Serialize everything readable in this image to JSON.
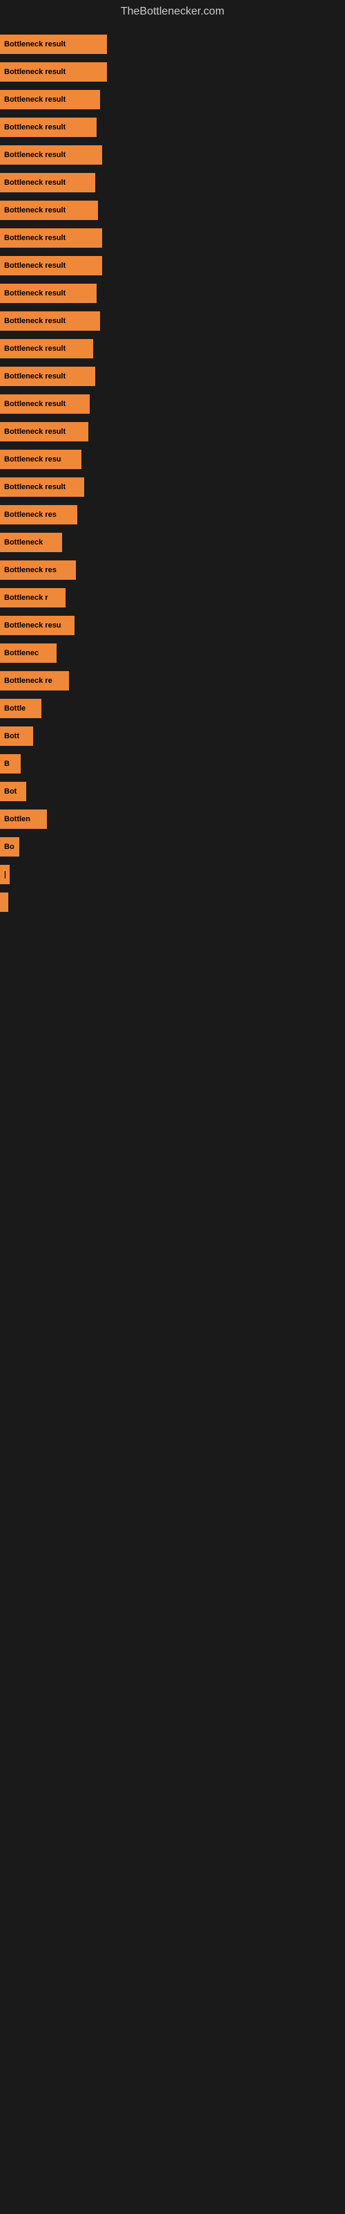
{
  "page": {
    "title": "TheBottlenecker.com",
    "background": "#1a1a1a"
  },
  "bars": [
    {
      "label": "Bottleneck result",
      "width": 155
    },
    {
      "label": "Bottleneck result",
      "width": 155
    },
    {
      "label": "Bottleneck result",
      "width": 145
    },
    {
      "label": "Bottleneck result",
      "width": 140
    },
    {
      "label": "Bottleneck result",
      "width": 148
    },
    {
      "label": "Bottleneck result",
      "width": 138
    },
    {
      "label": "Bottleneck result",
      "width": 142
    },
    {
      "label": "Bottleneck result",
      "width": 148
    },
    {
      "label": "Bottleneck result",
      "width": 148
    },
    {
      "label": "Bottleneck result",
      "width": 140
    },
    {
      "label": "Bottleneck result",
      "width": 145
    },
    {
      "label": "Bottleneck result",
      "width": 135
    },
    {
      "label": "Bottleneck result",
      "width": 138
    },
    {
      "label": "Bottleneck result",
      "width": 130
    },
    {
      "label": "Bottleneck result",
      "width": 128
    },
    {
      "label": "Bottleneck resu",
      "width": 118
    },
    {
      "label": "Bottleneck result",
      "width": 122
    },
    {
      "label": "Bottleneck res",
      "width": 112
    },
    {
      "label": "Bottleneck",
      "width": 90
    },
    {
      "label": "Bottleneck res",
      "width": 110
    },
    {
      "label": "Bottleneck r",
      "width": 95
    },
    {
      "label": "Bottleneck resu",
      "width": 108
    },
    {
      "label": "Bottlenec",
      "width": 82
    },
    {
      "label": "Bottleneck re",
      "width": 100
    },
    {
      "label": "Bottle",
      "width": 60
    },
    {
      "label": "Bott",
      "width": 48
    },
    {
      "label": "B",
      "width": 30
    },
    {
      "label": "Bot",
      "width": 38
    },
    {
      "label": "Bottlen",
      "width": 68
    },
    {
      "label": "Bo",
      "width": 28
    },
    {
      "label": "|",
      "width": 14
    },
    {
      "label": "▌",
      "width": 10
    }
  ]
}
